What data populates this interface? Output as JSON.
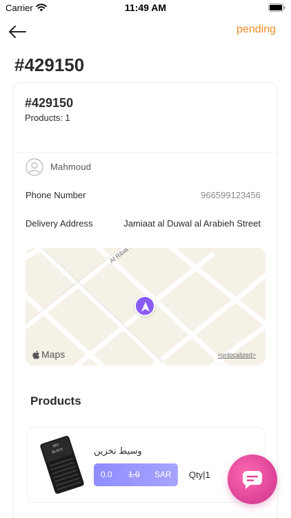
{
  "status_bar": {
    "carrier": "Carrier",
    "time": "11:49 AM"
  },
  "header": {
    "status": "pending",
    "title": "#429150"
  },
  "order": {
    "number": "#429150",
    "products_count": "Products: 1",
    "customer_name": "Mahmoud",
    "phone_label": "Phone Number",
    "phone_value": "966599123456",
    "address_label": "Delivery Address",
    "address_value": "Jamiaat al Duwal al Arabieh Street"
  },
  "map": {
    "street_label": "Al Ribat St",
    "provider": "Maps",
    "legal": "<unlocalized>"
  },
  "products": {
    "heading": "Products",
    "items": [
      {
        "name": "وسيط تخزين",
        "price_current": "0.0",
        "price_old": "1.0",
        "currency": "SAR",
        "qty": "Qty|1"
      }
    ]
  },
  "colors": {
    "status": "#f08a24",
    "accent": "#8a5cf6",
    "price_pill": "#9a97ff",
    "chat_fab": "#e0469a"
  }
}
